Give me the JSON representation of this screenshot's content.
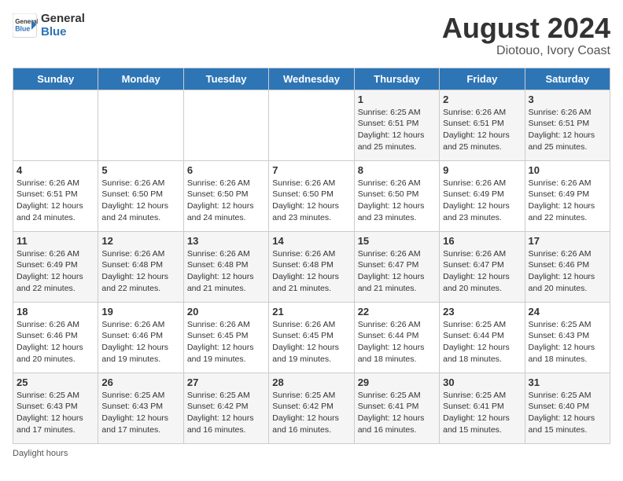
{
  "logo": {
    "line1": "General",
    "line2": "Blue"
  },
  "title": "August 2024",
  "subtitle": "Diotouo, Ivory Coast",
  "days_of_week": [
    "Sunday",
    "Monday",
    "Tuesday",
    "Wednesday",
    "Thursday",
    "Friday",
    "Saturday"
  ],
  "footer": "Daylight hours",
  "weeks": [
    [
      {
        "day": "",
        "info": ""
      },
      {
        "day": "",
        "info": ""
      },
      {
        "day": "",
        "info": ""
      },
      {
        "day": "",
        "info": ""
      },
      {
        "day": "1",
        "info": "Sunrise: 6:25 AM\nSunset: 6:51 PM\nDaylight: 12 hours\nand 25 minutes."
      },
      {
        "day": "2",
        "info": "Sunrise: 6:26 AM\nSunset: 6:51 PM\nDaylight: 12 hours\nand 25 minutes."
      },
      {
        "day": "3",
        "info": "Sunrise: 6:26 AM\nSunset: 6:51 PM\nDaylight: 12 hours\nand 25 minutes."
      }
    ],
    [
      {
        "day": "4",
        "info": "Sunrise: 6:26 AM\nSunset: 6:51 PM\nDaylight: 12 hours\nand 24 minutes."
      },
      {
        "day": "5",
        "info": "Sunrise: 6:26 AM\nSunset: 6:50 PM\nDaylight: 12 hours\nand 24 minutes."
      },
      {
        "day": "6",
        "info": "Sunrise: 6:26 AM\nSunset: 6:50 PM\nDaylight: 12 hours\nand 24 minutes."
      },
      {
        "day": "7",
        "info": "Sunrise: 6:26 AM\nSunset: 6:50 PM\nDaylight: 12 hours\nand 23 minutes."
      },
      {
        "day": "8",
        "info": "Sunrise: 6:26 AM\nSunset: 6:50 PM\nDaylight: 12 hours\nand 23 minutes."
      },
      {
        "day": "9",
        "info": "Sunrise: 6:26 AM\nSunset: 6:49 PM\nDaylight: 12 hours\nand 23 minutes."
      },
      {
        "day": "10",
        "info": "Sunrise: 6:26 AM\nSunset: 6:49 PM\nDaylight: 12 hours\nand 22 minutes."
      }
    ],
    [
      {
        "day": "11",
        "info": "Sunrise: 6:26 AM\nSunset: 6:49 PM\nDaylight: 12 hours\nand 22 minutes."
      },
      {
        "day": "12",
        "info": "Sunrise: 6:26 AM\nSunset: 6:48 PM\nDaylight: 12 hours\nand 22 minutes."
      },
      {
        "day": "13",
        "info": "Sunrise: 6:26 AM\nSunset: 6:48 PM\nDaylight: 12 hours\nand 21 minutes."
      },
      {
        "day": "14",
        "info": "Sunrise: 6:26 AM\nSunset: 6:48 PM\nDaylight: 12 hours\nand 21 minutes."
      },
      {
        "day": "15",
        "info": "Sunrise: 6:26 AM\nSunset: 6:47 PM\nDaylight: 12 hours\nand 21 minutes."
      },
      {
        "day": "16",
        "info": "Sunrise: 6:26 AM\nSunset: 6:47 PM\nDaylight: 12 hours\nand 20 minutes."
      },
      {
        "day": "17",
        "info": "Sunrise: 6:26 AM\nSunset: 6:46 PM\nDaylight: 12 hours\nand 20 minutes."
      }
    ],
    [
      {
        "day": "18",
        "info": "Sunrise: 6:26 AM\nSunset: 6:46 PM\nDaylight: 12 hours\nand 20 minutes."
      },
      {
        "day": "19",
        "info": "Sunrise: 6:26 AM\nSunset: 6:46 PM\nDaylight: 12 hours\nand 19 minutes."
      },
      {
        "day": "20",
        "info": "Sunrise: 6:26 AM\nSunset: 6:45 PM\nDaylight: 12 hours\nand 19 minutes."
      },
      {
        "day": "21",
        "info": "Sunrise: 6:26 AM\nSunset: 6:45 PM\nDaylight: 12 hours\nand 19 minutes."
      },
      {
        "day": "22",
        "info": "Sunrise: 6:26 AM\nSunset: 6:44 PM\nDaylight: 12 hours\nand 18 minutes."
      },
      {
        "day": "23",
        "info": "Sunrise: 6:25 AM\nSunset: 6:44 PM\nDaylight: 12 hours\nand 18 minutes."
      },
      {
        "day": "24",
        "info": "Sunrise: 6:25 AM\nSunset: 6:43 PM\nDaylight: 12 hours\nand 18 minutes."
      }
    ],
    [
      {
        "day": "25",
        "info": "Sunrise: 6:25 AM\nSunset: 6:43 PM\nDaylight: 12 hours\nand 17 minutes."
      },
      {
        "day": "26",
        "info": "Sunrise: 6:25 AM\nSunset: 6:43 PM\nDaylight: 12 hours\nand 17 minutes."
      },
      {
        "day": "27",
        "info": "Sunrise: 6:25 AM\nSunset: 6:42 PM\nDaylight: 12 hours\nand 16 minutes."
      },
      {
        "day": "28",
        "info": "Sunrise: 6:25 AM\nSunset: 6:42 PM\nDaylight: 12 hours\nand 16 minutes."
      },
      {
        "day": "29",
        "info": "Sunrise: 6:25 AM\nSunset: 6:41 PM\nDaylight: 12 hours\nand 16 minutes."
      },
      {
        "day": "30",
        "info": "Sunrise: 6:25 AM\nSunset: 6:41 PM\nDaylight: 12 hours\nand 15 minutes."
      },
      {
        "day": "31",
        "info": "Sunrise: 6:25 AM\nSunset: 6:40 PM\nDaylight: 12 hours\nand 15 minutes."
      }
    ]
  ]
}
